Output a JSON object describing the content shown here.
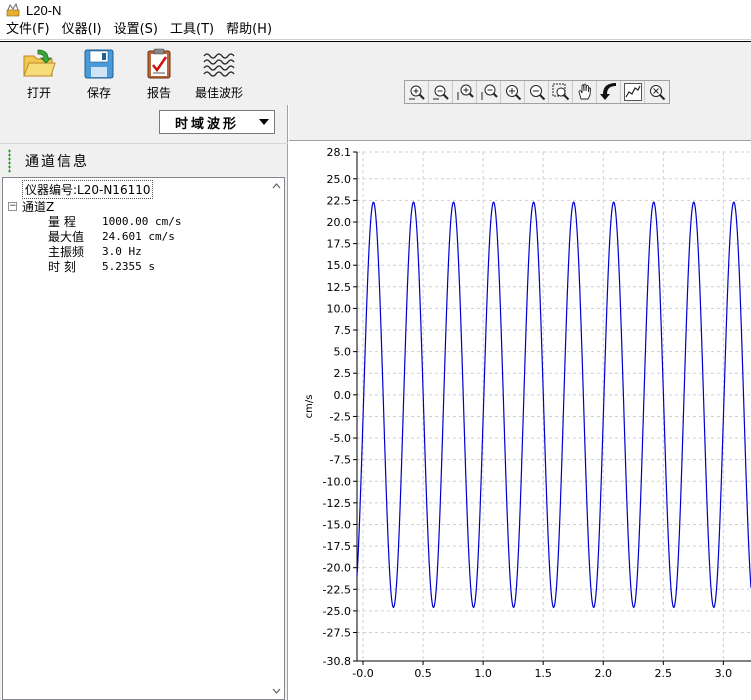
{
  "window": {
    "title": "L20-N"
  },
  "menu": [
    {
      "label": "文件(F)"
    },
    {
      "label": "仪器(I)"
    },
    {
      "label": "设置(S)"
    },
    {
      "label": "工具(T)"
    },
    {
      "label": "帮助(H)"
    }
  ],
  "toolbar": {
    "open_label": "打开",
    "save_label": "保存",
    "report_label": "报告",
    "best_wave_label": "最佳波形",
    "zoom_tools": [
      "zoom-in-x-icon",
      "zoom-out-x-icon",
      "zoom-in-y-icon",
      "zoom-out-y-icon",
      "zoom-in-icon",
      "zoom-out-icon",
      "zoom-region-icon",
      "hand-pan-icon",
      "undo-arrow-icon",
      "waveform-icon",
      "reset-zoom-icon"
    ]
  },
  "view": {
    "selected": "时域波形"
  },
  "channel_panel": {
    "header": "通道信息",
    "instrument": "仪器编号:L20-N16110",
    "channel_name": "通道Z",
    "rows": [
      {
        "key": "量  程",
        "value": "1000.00 cm/s"
      },
      {
        "key": "最大值",
        "value": "24.601 cm/s"
      },
      {
        "key": "主振频",
        "value": "3.0 Hz"
      },
      {
        "key": "时  刻",
        "value": "5.2355 s"
      }
    ]
  },
  "chart_data": {
    "type": "line",
    "title": "",
    "xlabel": "",
    "ylabel": "cm/s",
    "xlim": [
      -0.05,
      3.23
    ],
    "ylim": [
      -30.8,
      28.1
    ],
    "x_ticks": [
      "-0.0",
      "0.5",
      "1.0",
      "1.5",
      "2.0",
      "2.5",
      "3.0"
    ],
    "y_ticks": [
      "28.1",
      "25.0",
      "22.5",
      "20.0",
      "17.5",
      "15.0",
      "12.5",
      "10.0",
      "7.5",
      "5.0",
      "2.5",
      "0.0",
      "-2.5",
      "-5.0",
      "-7.5",
      "-10.0",
      "-12.5",
      "-15.0",
      "-17.5",
      "-20.0",
      "-22.5",
      "-25.0",
      "-27.5",
      "-30.8"
    ],
    "grid": true,
    "series": [
      {
        "frequency_hz": 3.0,
        "amplitude_pos": 22.3,
        "amplitude_neg": -24.6,
        "color": "#0000cc",
        "x_start": -0.05,
        "x_end": 3.23
      }
    ]
  }
}
